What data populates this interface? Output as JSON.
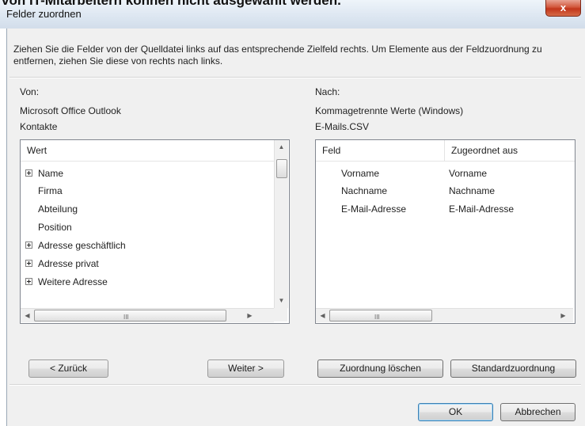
{
  "page_caption": "von IT-Mitarbeitern können nicht ausgewählt werden.",
  "window": {
    "title": "Felder zuordnen",
    "close_glyph": "x"
  },
  "instructions": "Ziehen Sie die Felder von der Quelldatei links auf das entsprechende Zielfeld rechts. Um Elemente aus der Feldzuordnung zu entfernen, ziehen Sie diese von rechts nach links.",
  "source": {
    "heading": "Von:",
    "application": "Microsoft Office Outlook",
    "folder": "Kontakte",
    "column_header": "Wert",
    "items": [
      {
        "label": "Name",
        "expandable": true
      },
      {
        "label": "Firma",
        "expandable": false
      },
      {
        "label": "Abteilung",
        "expandable": false
      },
      {
        "label": "Position",
        "expandable": false
      },
      {
        "label": "Adresse geschäftlich",
        "expandable": true
      },
      {
        "label": "Adresse privat",
        "expandable": true
      },
      {
        "label": "Weitere Adresse",
        "expandable": true
      }
    ]
  },
  "target": {
    "heading": "Nach:",
    "format": "Kommagetrennte Werte (Windows)",
    "file": "E-Mails.CSV",
    "columns": [
      "Feld",
      "Zugeordnet aus"
    ],
    "rows": [
      {
        "field": "Vorname",
        "mapped_from": "Vorname"
      },
      {
        "field": "Nachname",
        "mapped_from": "Nachname"
      },
      {
        "field": "E-Mail-Adresse",
        "mapped_from": "E-Mail-Adresse"
      }
    ]
  },
  "buttons": {
    "back": "< Zurück",
    "next": "Weiter >",
    "clear_mapping": "Zuordnung löschen",
    "default_mapping": "Standardzuordnung",
    "ok": "OK",
    "cancel": "Abbrechen"
  },
  "icons": {
    "expand": "plus-box-icon",
    "scroll_up": "▲",
    "scroll_down": "▼",
    "scroll_left": "◀",
    "scroll_right": "▶",
    "grip": "III"
  }
}
